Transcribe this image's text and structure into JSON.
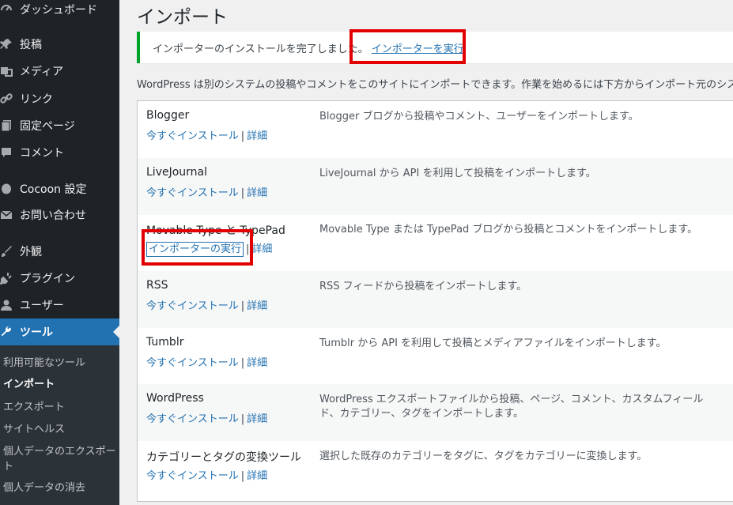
{
  "sidebar": {
    "items": [
      {
        "label": "ダッシュボード",
        "icon": "dashboard-icon"
      },
      {
        "label": "投稿",
        "icon": "pin-icon"
      },
      {
        "label": "メディア",
        "icon": "media-icon"
      },
      {
        "label": "リンク",
        "icon": "link-icon"
      },
      {
        "label": "固定ページ",
        "icon": "page-icon"
      },
      {
        "label": "コメント",
        "icon": "comment-icon"
      },
      {
        "label": "Cocoon 設定",
        "icon": "cocoon-icon"
      },
      {
        "label": "お問い合わせ",
        "icon": "mail-icon"
      },
      {
        "label": "外観",
        "icon": "appearance-icon"
      },
      {
        "label": "プラグイン",
        "icon": "plugin-icon"
      },
      {
        "label": "ユーザー",
        "icon": "user-icon"
      },
      {
        "label": "ツール",
        "icon": "wrench-icon"
      }
    ],
    "submenu": [
      {
        "label": "利用可能なツール"
      },
      {
        "label": "インポート"
      },
      {
        "label": "エクスポート"
      },
      {
        "label": "サイトヘルス"
      },
      {
        "label": "個人データのエクスポート"
      },
      {
        "label": "個人データの消去"
      }
    ]
  },
  "page": {
    "title": "インポート",
    "notice_text": "インポーターのインストールを完了しました。",
    "notice_link": "インポーターを実行",
    "intro": "WordPress は別のシステムの投稿やコメントをこのサイトにインポートできます。作業を始めるには下方からインポート元のシス"
  },
  "importers": [
    {
      "name": "Blogger",
      "install": "今すぐインストール",
      "sep": "|",
      "details": "詳細",
      "desc": "Blogger ブログから投稿やコメント、ユーザーをインポートします。"
    },
    {
      "name": "LiveJournal",
      "install": "今すぐインストール",
      "sep": "|",
      "details": "詳細",
      "desc": "LiveJournal から API を利用して投稿をインポートします。"
    },
    {
      "name": "Movable Type と TypePad",
      "install": "インポーターの実行",
      "sep": "|",
      "details": "詳細",
      "desc": "Movable Type または TypePad ブログから投稿とコメントをインポートします。"
    },
    {
      "name": "RSS",
      "install": "今すぐインストール",
      "sep": "|",
      "details": "詳細",
      "desc": "RSS フィードから投稿をインポートします。"
    },
    {
      "name": "Tumblr",
      "install": "今すぐインストール",
      "sep": "|",
      "details": "詳細",
      "desc": "Tumblr から API を利用して投稿とメディアファイルをインポートします。"
    },
    {
      "name": "WordPress",
      "install": "今すぐインストール",
      "sep": "|",
      "details": "詳細",
      "desc": "WordPress エクスポートファイルから投稿、ページ、コメント、カスタムフィールド、カテゴリー、タグをインポートします。"
    },
    {
      "name": "カテゴリーとタグの変換ツール",
      "install": "今すぐインストール",
      "sep": "|",
      "details": "詳細",
      "desc": "選択した既存のカテゴリーをタグに、タグをカテゴリーに変換します。"
    }
  ],
  "colors": {
    "accent": "#2271b1",
    "sidebar": "#1d2327",
    "highlight": "#e20000",
    "success": "#00a32a"
  }
}
